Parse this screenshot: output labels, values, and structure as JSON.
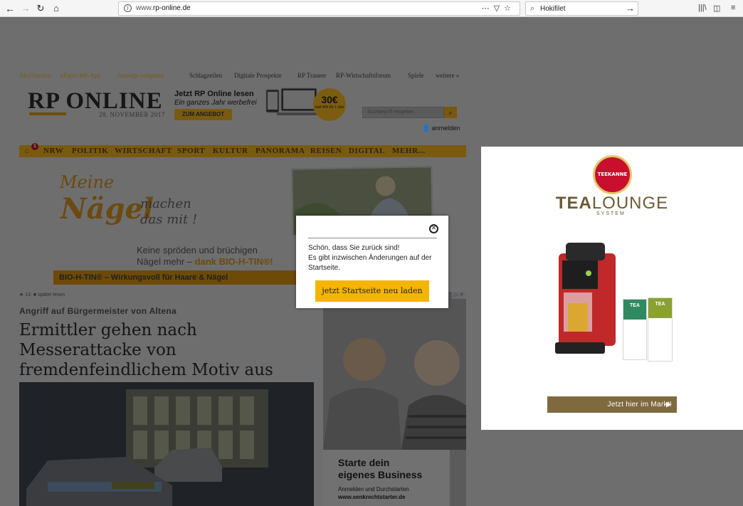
{
  "browser": {
    "url_prefix": "www.",
    "url_domain": "rp-online.de",
    "search_query": "Hokifilet"
  },
  "site": {
    "toplinks_left": [
      "Abo/Service",
      "ePaper/RP-App",
      "Anzeige aufgeben"
    ],
    "toplinks_right": [
      "Schlagzeilen",
      "Digitale Prospekte",
      "RP Traueer",
      "RP-Wirtschaftsforum",
      "Spiele",
      "weitere »"
    ],
    "logo": "RP ONLINE",
    "date": "28. NOVEMBER 2017",
    "promo": {
      "title": "Jetzt RP Online lesen",
      "subtitle": "Ein ganzes Jahr werbefrei",
      "button": "ZUM ANGEBOT",
      "badge_price": "30€",
      "badge_note": "statt 40€ für 1 Jahr"
    },
    "search_placeholder": "Suchbegriff eingeben",
    "login_label": "anmelden",
    "nav_badge": "1",
    "nav": [
      "NRW",
      "POLITIK",
      "WIRTSCHAFT",
      "SPORT",
      "KULTUR",
      "PANORAMA",
      "REISEN",
      "DIGITAL",
      "MEHR..."
    ]
  },
  "ad_banner": {
    "line1": "Meine",
    "line2": "Nägel",
    "line3a": "machen",
    "line3b": "das mit !",
    "claim1": "Keine spröden und brüchigen",
    "claim2a": "Nägel mehr – ",
    "claim2b": "dank BIO-H-TIN®!",
    "ribbon": "BIO-H-TIN® – Wirkungsvoll für Haare & Nägel"
  },
  "article": {
    "meta_count": "13",
    "meta_later": "später lesen",
    "kicker": "Angriff auf Bürgermeister von Altena",
    "headline": "Ermittler gehen nach Messerattacke von fremdenfeindlichem Motiv aus"
  },
  "side_ad": {
    "title1": "Starte dein",
    "title2": "eigenes Business",
    "text1": "Anmelden und Durchstarten",
    "text2": "www.senkrechtstarter.de"
  },
  "tea_ad": {
    "emblem": "TEEKANNE",
    "brand_bold": "TEA",
    "brand_rest": "LOUNGE",
    "system": "SYSTEM",
    "box1_label": "TEA",
    "box2_label": "TEA",
    "cta": "Jetzt hier im Markt!"
  },
  "modal": {
    "line1": "Schön, dass Sie zurück sind!",
    "line2": "Es gibt inzwischen Änderungen auf der Startseite.",
    "button": "jetzt Startseite neu laden"
  }
}
